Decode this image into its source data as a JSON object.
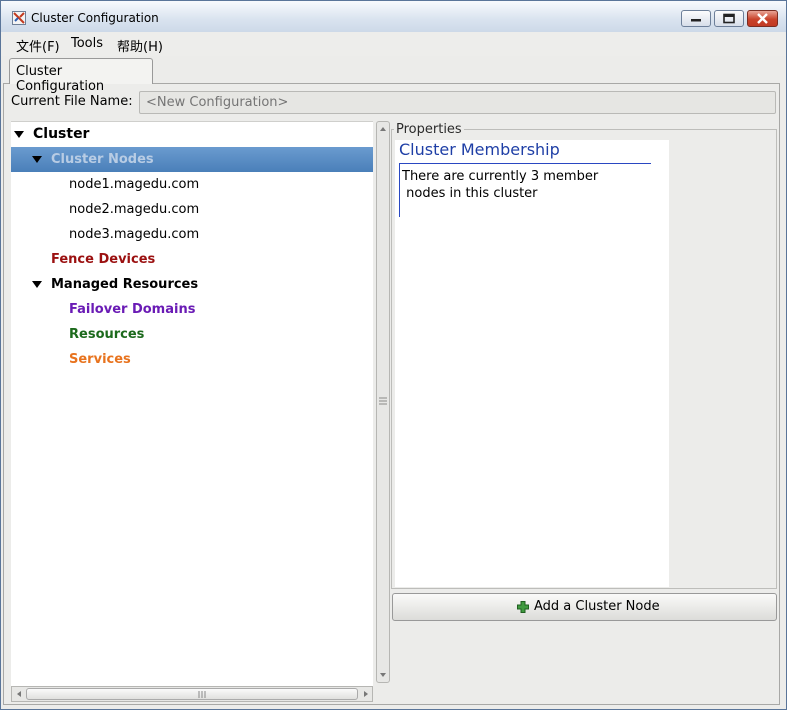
{
  "window": {
    "title": "Cluster Configuration"
  },
  "menu": {
    "file": "文件(F)",
    "tools": "Tools",
    "help": "帮助(H)"
  },
  "tabs": [
    {
      "label": "Cluster Configuration"
    }
  ],
  "file_name": {
    "label": "Current File Name:",
    "placeholder": "<New Configuration>"
  },
  "tree": {
    "root": "Cluster",
    "cluster_nodes": "Cluster Nodes",
    "nodes": [
      "node1.magedu.com",
      "node2.magedu.com",
      "node3.magedu.com"
    ],
    "fence_devices": "Fence Devices",
    "managed_resources": "Managed Resources",
    "failover_domains": "Failover Domains",
    "resources": "Resources",
    "services": "Services"
  },
  "properties": {
    "label": "Properties",
    "title": "Cluster Membership",
    "text": "There are currently 3 member\n nodes in this cluster"
  },
  "add_button": {
    "label": "Add a Cluster Node"
  },
  "colors": {
    "selection": "#4a7fb9",
    "fence": "#9b1010",
    "failover": "#6a1bb5",
    "resources": "#1c6a1c",
    "services": "#e8731e",
    "heading": "#1f3fa6"
  }
}
